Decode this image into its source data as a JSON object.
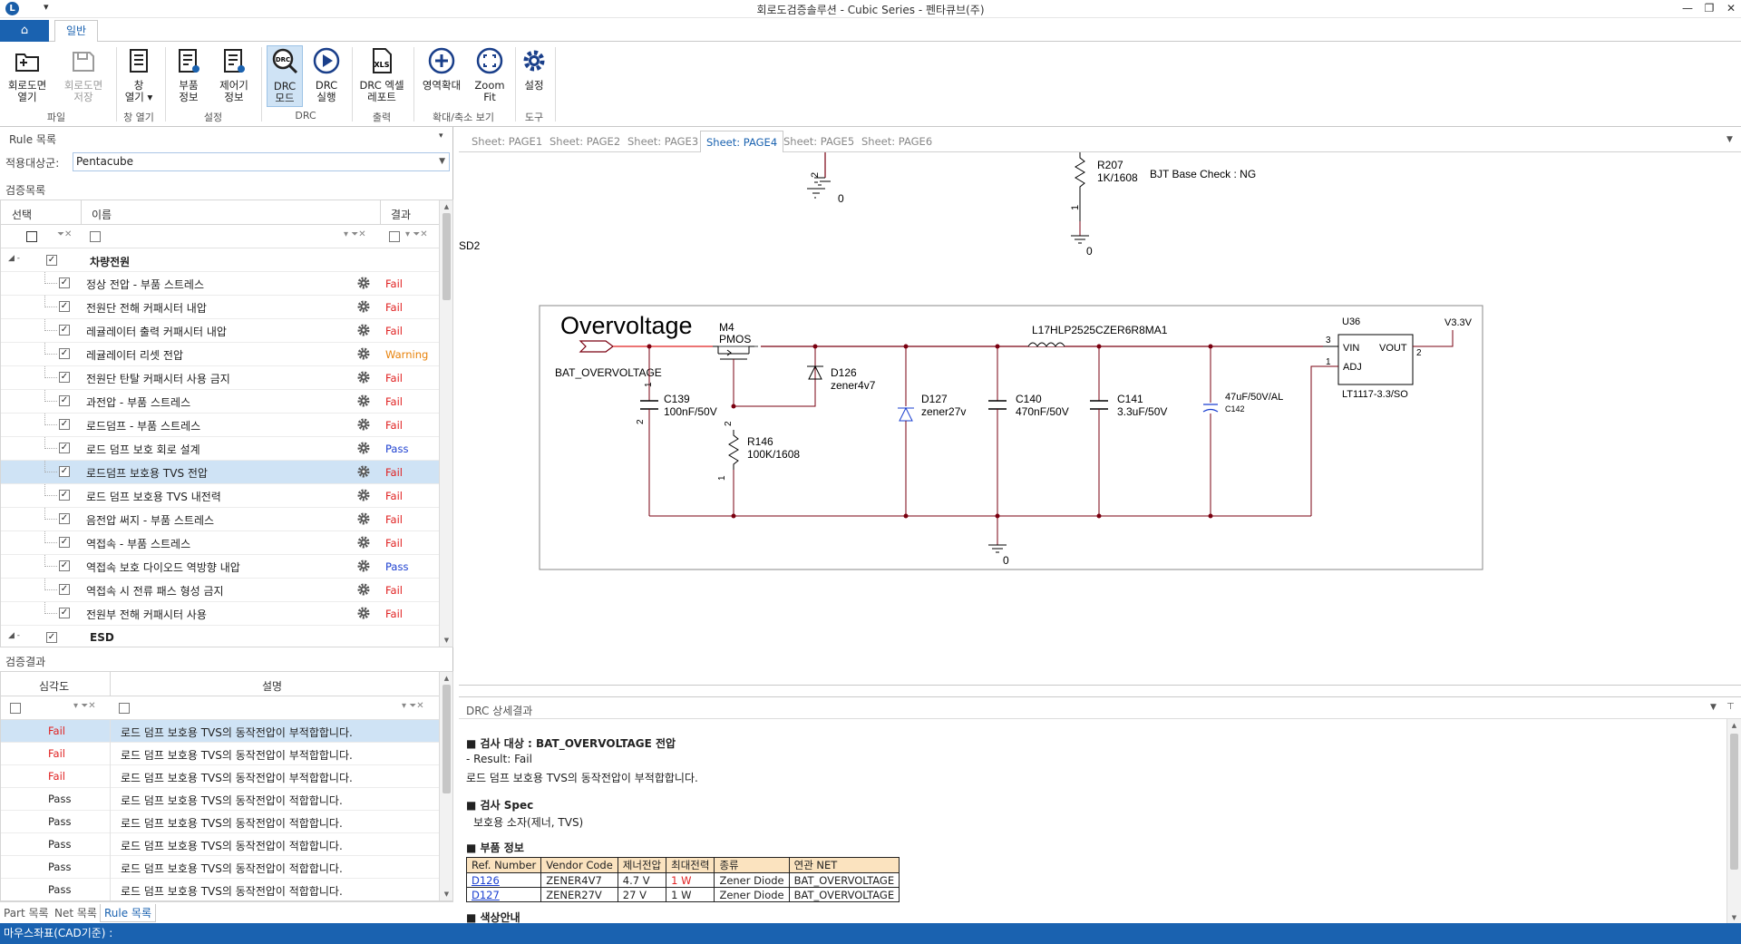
{
  "window": {
    "title": "회로도검증솔루션 - Cubic Series - 펜타큐브(주)",
    "min": "—",
    "restore": "❐",
    "close": "✕"
  },
  "qat": {
    "label": "▾"
  },
  "ribbon": {
    "tabs": {
      "home": "⌂",
      "general": "일반"
    },
    "buttons": {
      "open": "회로도면\n열기",
      "save": "회로도면\n저장",
      "window": "창\n열기 ▾",
      "parts": "부품\n정보",
      "controls": "제어기\n정보",
      "drc_mode": "DRC\n모드",
      "drc_run": "DRC\n실행",
      "drc_excel": "DRC 엑셀\n레포트",
      "zoom_area": "영역확대",
      "zoom_fit": "Zoom\nFit",
      "settings": "설정"
    },
    "groups": {
      "file": "파일",
      "window": "창 열기",
      "settings": "설정",
      "drc": "DRC",
      "output": "출력",
      "zoom": "확대/축소 보기",
      "tools": "도구"
    }
  },
  "left": {
    "rule_title": "Rule 목록",
    "pin": "▾",
    "target_label": "적용대상군:",
    "target_value": "Pentacube",
    "check_list_title": "검증목록",
    "columns": {
      "select": "선택",
      "name": "이름",
      "result": "결과"
    },
    "group1": "차량전원",
    "group2": "ESD",
    "rules": [
      {
        "name": "정상 전압 - 부품 스트레스",
        "result": "Fail"
      },
      {
        "name": "전원단 전해 커패시터 내압",
        "result": "Fail"
      },
      {
        "name": "레귤레이터 출력 커패시터 내압",
        "result": "Fail"
      },
      {
        "name": "레귤레이터 리셋 전압",
        "result": "Warning"
      },
      {
        "name": "전원단 탄탈 커패시터 사용 금지",
        "result": "Fail"
      },
      {
        "name": "과전압 - 부품 스트레스",
        "result": "Fail"
      },
      {
        "name": "로드덤프 - 부품 스트레스",
        "result": "Fail"
      },
      {
        "name": "로드 덤프 보호 회로 설계",
        "result": "Pass"
      },
      {
        "name": "로드덤프 보호용 TVS 전압",
        "result": "Fail"
      },
      {
        "name": "로드 덤프 보호용 TVS 내전력",
        "result": "Fail"
      },
      {
        "name": "음전압 써지 - 부품 스트레스",
        "result": "Fail"
      },
      {
        "name": "역접속 - 부품 스트레스",
        "result": "Fail"
      },
      {
        "name": "역접속 보호 다이오드 역방향 내압",
        "result": "Pass"
      },
      {
        "name": "역접속 시 전류 패스 형성 금지",
        "result": "Fail"
      },
      {
        "name": "전원부 전해 커패시터 사용",
        "result": "Fail"
      }
    ],
    "result_title": "검증결과",
    "result_columns": {
      "severity": "심각도",
      "desc": "설명"
    },
    "results": [
      {
        "sev": "Fail",
        "desc": "로드 덤프 보호용 TVS의 동작전압이 부적합합니다."
      },
      {
        "sev": "Fail",
        "desc": "로드 덤프 보호용 TVS의 동작전압이 부적합합니다."
      },
      {
        "sev": "Fail",
        "desc": "로드 덤프 보호용 TVS의 동작전압이 부적합합니다."
      },
      {
        "sev": "Pass",
        "desc": "로드 덤프 보호용 TVS의 동작전압이 적합합니다."
      },
      {
        "sev": "Pass",
        "desc": "로드 덤프 보호용 TVS의 동작전압이 적합합니다."
      },
      {
        "sev": "Pass",
        "desc": "로드 덤프 보호용 TVS의 동작전압이 적합합니다."
      },
      {
        "sev": "Pass",
        "desc": "로드 덤프 보호용 TVS의 동작전압이 적합합니다."
      },
      {
        "sev": "Pass",
        "desc": "로드 덤프 보호용 TVS의 동작전압이 적합합니다."
      }
    ],
    "bottom_tabs": {
      "part": "Part 목록",
      "net": "Net 목록",
      "rule": "Rule 목록"
    }
  },
  "sheets": [
    "Sheet: PAGE1",
    "Sheet: PAGE2",
    "Sheet: PAGE3",
    "Sheet: PAGE4",
    "Sheet: PAGE5",
    "Sheet: PAGE6"
  ],
  "schematic": {
    "title": "Overvoltage",
    "net_bat": "BAT_OVERVOLTAGE",
    "gnd0": "0",
    "sd2": "SD2",
    "r207_ref": "R207",
    "r207_val": "1K/1608",
    "bjt": "BJT Base Check : NG",
    "m4_ref": "M4",
    "m4_val": "PMOS",
    "c139_ref": "C139",
    "c139_val": "100nF/50V",
    "r146_ref": "R146",
    "r146_val": "100K/1608",
    "d126_ref": "D126",
    "d126_val": "zener4v7",
    "d127_ref": "D127",
    "d127_val": "zener27v",
    "c140_ref": "C140",
    "c140_val": "470nF/50V",
    "c141_ref": "C141",
    "c141_val": "3.3uF/50V",
    "c142_val": "47uF/50V/AL",
    "c142_ref": "C142",
    "l17": "L17HLP2525CZER6R8MA1",
    "u36": "U36",
    "u36_part": "LT1117-3.3/SO",
    "vin": "VIN",
    "vout": "VOUT",
    "adj": "ADJ",
    "v33": "V3.3V",
    "pin1": "1",
    "pin2": "2",
    "pin3": "3"
  },
  "drc": {
    "title": "DRC 상세결과",
    "target_label": "■ 검사 대상 : BAT_OVERVOLTAGE 전압",
    "result": "- Result: Fail",
    "message": "로드 덤프 보호용 TVS의 동작전압이 부적합합니다.",
    "spec_label": "■ 검사 Spec",
    "spec_value": "보호용 소자(제너, TVS)",
    "part_label": "■ 부품 정보",
    "table_headers": [
      "Ref. Number",
      "Vendor Code",
      "제너전압",
      "최대전력",
      "종류",
      "연관 NET"
    ],
    "table_rows": [
      [
        "D126",
        "ZENER4V7",
        "4.7 V",
        "1 W",
        "Zener Diode",
        "BAT_OVERVOLTAGE"
      ],
      [
        "D127",
        "ZENER27V",
        "27 V",
        "1 W",
        "Zener Diode",
        "BAT_OVERVOLTAGE"
      ]
    ],
    "next_section": "■ 색상안내"
  },
  "status": {
    "text": "마우스좌표(CAD기준) :"
  },
  "colors": {
    "accent": "#1a62b0",
    "fail": "#e02020",
    "warning": "#e8820a",
    "pass": "#1c3fd0",
    "wire_net": "#e02020",
    "wire_dark": "#7a0010"
  }
}
